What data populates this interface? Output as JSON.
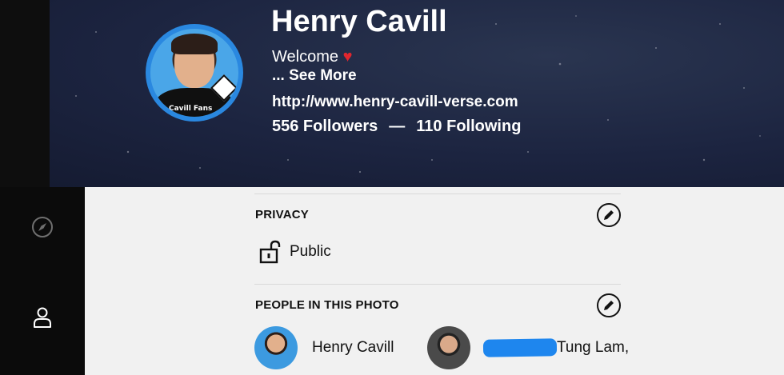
{
  "profile": {
    "name": "Henry Cavill",
    "welcome": "Welcome",
    "heart": "♥",
    "see_more": "...  See More",
    "link": "http://www.henry-cavill-verse.com",
    "followers": "556 Followers",
    "separator": "—",
    "following": "110 Following",
    "avatar_caption": "y Cavill Fans"
  },
  "sidebar": {
    "items": [
      {
        "icon": "compass-icon",
        "active": false
      },
      {
        "icon": "user-icon",
        "active": true
      }
    ]
  },
  "privacy": {
    "title": "PRIVACY",
    "value": "Public"
  },
  "people": {
    "title": "PEOPLE IN THIS PHOTO",
    "list": [
      {
        "name": "Henry Cavill"
      },
      {
        "name": "Tung Lam,"
      }
    ]
  },
  "colors": {
    "banner": "#1c2440",
    "avatar_ring": "#2a88e0",
    "heart": "#e0262e",
    "redaction": "#1e86ee"
  }
}
